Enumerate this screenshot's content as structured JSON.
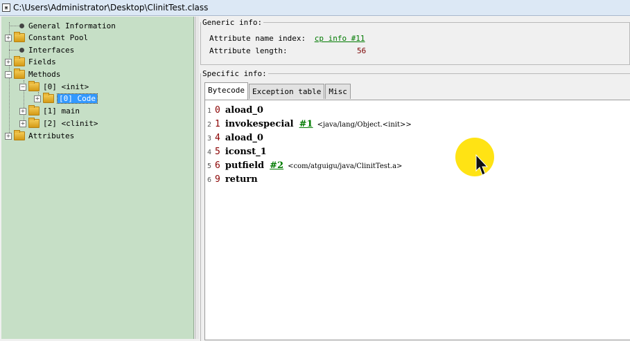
{
  "window": {
    "title": "C:\\Users\\Administrator\\Desktop\\ClinitTest.class",
    "icon": "class-file-icon"
  },
  "tree": {
    "items": [
      {
        "label": "General Information",
        "icon": "leaf-dot-icon"
      },
      {
        "label": "Constant Pool",
        "icon": "folder-icon",
        "expander": "+"
      },
      {
        "label": "Interfaces",
        "icon": "leaf-dot-icon"
      },
      {
        "label": "Fields",
        "icon": "folder-icon",
        "expander": "+"
      },
      {
        "label": "Methods",
        "icon": "folder-icon",
        "expander": "−"
      },
      {
        "label": "[0] <init>",
        "icon": "folder-icon",
        "expander": "−"
      },
      {
        "label": "[0] Code",
        "icon": "folder-icon",
        "expander": "+",
        "selected": true
      },
      {
        "label": "[1] main",
        "icon": "folder-icon",
        "expander": "+"
      },
      {
        "label": "[2] <clinit>",
        "icon": "folder-icon",
        "expander": "+"
      },
      {
        "label": "Attributes",
        "icon": "folder-icon",
        "expander": "+"
      }
    ]
  },
  "generic": {
    "legend": "Generic info:",
    "name_index_label": "Attribute name index:",
    "name_index_value": "cp info #11",
    "length_label": "Attribute length:",
    "length_value": "56"
  },
  "specific": {
    "legend": "Specific info:",
    "tabs": [
      "Bytecode",
      "Exception table",
      "Misc"
    ],
    "active_tab": "Bytecode"
  },
  "bytecode": [
    {
      "line": "1",
      "offset": "0",
      "op": "aload_0",
      "ref": "",
      "comment": ""
    },
    {
      "line": "2",
      "offset": "1",
      "op": "invokespecial",
      "ref": "#1",
      "comment": "<java/lang/Object.<init>>"
    },
    {
      "line": "3",
      "offset": "4",
      "op": "aload_0",
      "ref": "",
      "comment": ""
    },
    {
      "line": "4",
      "offset": "5",
      "op": "iconst_1",
      "ref": "",
      "comment": ""
    },
    {
      "line": "5",
      "offset": "6",
      "op": "putfield",
      "ref": "#2",
      "comment": "<com/atguigu/java/ClinitTest.a>"
    },
    {
      "line": "6",
      "offset": "9",
      "op": "return",
      "ref": "",
      "comment": ""
    }
  ],
  "colors": {
    "tree_bg": "#c6dfc6",
    "selection": "#3399ff",
    "link": "#007a00",
    "offset": "#8a0000",
    "cursor_halo": "#ffe100"
  }
}
